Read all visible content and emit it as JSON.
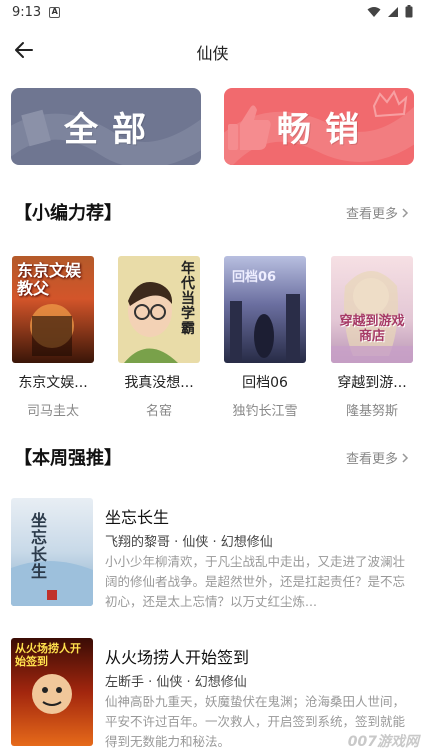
{
  "status_bar": {
    "time": "9:13"
  },
  "header": {
    "title": "仙侠"
  },
  "banners": {
    "all_label": "全部",
    "hot_label": "畅销"
  },
  "recommend": {
    "title": "【小编力荐】",
    "more_label": "查看更多",
    "books": [
      {
        "title": "东京文娱...",
        "author": "司马圭太",
        "cover_text": "东京文娱教父"
      },
      {
        "title": "我真没想...",
        "author": "名窑",
        "cover_text": "年代当学霸"
      },
      {
        "title": "回档06",
        "author": "独钓长江雪",
        "cover_text": "回档06"
      },
      {
        "title": "穿越到游...",
        "author": "隆基努斯",
        "cover_text": "穿越到游戏商店"
      }
    ]
  },
  "weekly": {
    "title": "【本周强推】",
    "more_label": "查看更多",
    "items": [
      {
        "name": "坐忘长生",
        "meta": "飞翔的黎哥 · 仙侠 · 幻想修仙",
        "desc": "小小少年柳清欢，于凡尘战乱中走出，又走进了波澜壮阔的修仙者战争。是超然世外，还是扛起责任？是不忘初心，还是太上忘情？以万丈红尘炼...",
        "cover_text": "坐忘长生"
      },
      {
        "name": "从火场捞人开始签到",
        "meta": "左断手 · 仙侠 · 幻想修仙",
        "desc": "仙神高卧九重天，妖魔蛰伏在鬼渊；沧海桑田人世间，平安不许过百年。一次救人，开启签到系统，签到就能得到无数能力和秘法。",
        "cover_text": "从火场捞人开始签到"
      }
    ]
  },
  "watermark": "007游戏网",
  "colors": {
    "banner_all": "#6f7691",
    "banner_hot": "#f16a6e"
  }
}
